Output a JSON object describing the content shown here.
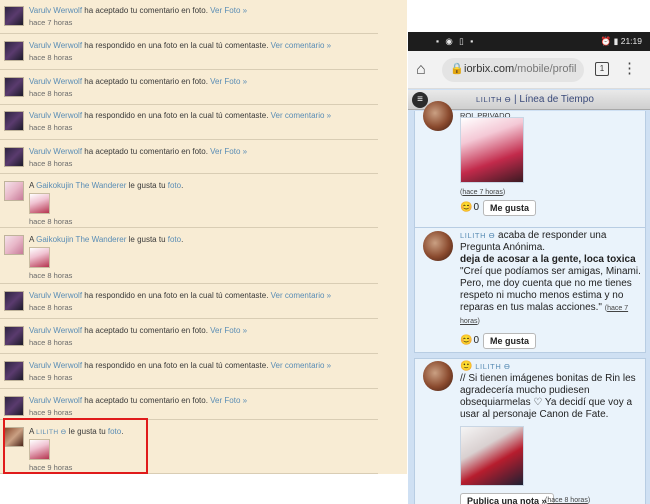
{
  "notifications": [
    {
      "user": "Varulv Werwolf",
      "action": " ha aceptado tu comentario en foto. ",
      "link": "Ver Foto »",
      "time": "hace 7 horas",
      "avatar": "dark"
    },
    {
      "user": "Varulv Werwolf",
      "action": " ha respondido en una foto en la cual tú comentaste. ",
      "link": "Ver comentario »",
      "time": "hace 8 horas",
      "avatar": "dark"
    },
    {
      "user": "Varulv Werwolf",
      "action": " ha aceptado tu comentario en foto. ",
      "link": "Ver Foto »",
      "time": "hace 8 horas",
      "avatar": "dark"
    },
    {
      "user": "Varulv Werwolf",
      "action": " ha respondido en una foto en la cual tú comentaste. ",
      "link": "Ver comentario »",
      "time": "hace 8 horas",
      "avatar": "dark"
    },
    {
      "user": "Varulv Werwolf",
      "action": " ha aceptado tu comentario en foto. ",
      "link": "Ver Foto »",
      "time": "hace 8 horas",
      "avatar": "dark"
    },
    {
      "prefix": "A ",
      "user": "Gaikokujin The Wanderer",
      "action": " le gusta tu ",
      "link": "foto",
      "suffix": ".",
      "time": "hace 8 horas",
      "avatar": "girl",
      "thumb": true
    },
    {
      "prefix": "A ",
      "user": "Gaikokujin The Wanderer",
      "action": " le gusta tu ",
      "link": "foto",
      "suffix": ".",
      "time": "hace 8 horas",
      "avatar": "girl",
      "thumb": true
    },
    {
      "user": "Varulv Werwolf",
      "action": " ha respondido en una foto en la cual tú comentaste. ",
      "link": "Ver comentario »",
      "time": "hace 8 horas",
      "avatar": "dark"
    },
    {
      "user": "Varulv Werwolf",
      "action": " ha aceptado tu comentario en foto. ",
      "link": "Ver Foto »",
      "time": "hace 8 horas",
      "avatar": "dark"
    },
    {
      "user": "Varulv Werwolf",
      "action": " ha respondido en una foto en la cual tú comentaste. ",
      "link": "Ver comentario »",
      "time": "hace 9 horas",
      "avatar": "dark"
    },
    {
      "user": "Varulv Werwolf",
      "action": " ha aceptado tu comentario en foto. ",
      "link": "Ver Foto »",
      "time": "hace 9 horas",
      "avatar": "dark"
    },
    {
      "prefix": "A ",
      "user": "LILITH ϴ",
      "action": " le gusta tu ",
      "link": "foto",
      "suffix": ".",
      "time": "hace 9 horas",
      "avatar": "lilith",
      "thumb": true
    }
  ],
  "phone": {
    "status_time": "21:19",
    "status_icons_left": "▪ ◉ ▯ ▪",
    "status_icons_right": "⏰ ▮",
    "url_main": "iorbix.com",
    "url_path": "/mobile/profil",
    "tab_count": "1",
    "appbar_name": "LILITH ϴ",
    "appbar_sep": " | ",
    "appbar_title": "Línea de Tiempo",
    "post1": {
      "label": "ROL PRIVADO",
      "time": "hace 7 horas",
      "like_count": "0",
      "like_label": "Me gusta"
    },
    "post2": {
      "name": "LILITH ϴ",
      "lead": " acaba de responder una Pregunta Anónima.",
      "question": "deja de acosar a la gente, loca toxica",
      "answer": "\"Creí que podíamos ser amigas, Minami. Pero, me doy cuenta que no me tienes respeto ni mucho menos estima y no reparas en tus malas acciones.\"",
      "time": "hace 7 horas",
      "like_count": "0",
      "like_label": "Me gusta"
    },
    "post3": {
      "name": "LILITH ϴ",
      "text": "// Si tienen imágenes bonitas de Rin les agradecería mucho pudiesen obsequiarmelas ♡ Ya decidí que voy a usar al personaje Canon de Fate.",
      "publish_label": "Publica una nota »",
      "time": "hace 8 horas"
    }
  }
}
